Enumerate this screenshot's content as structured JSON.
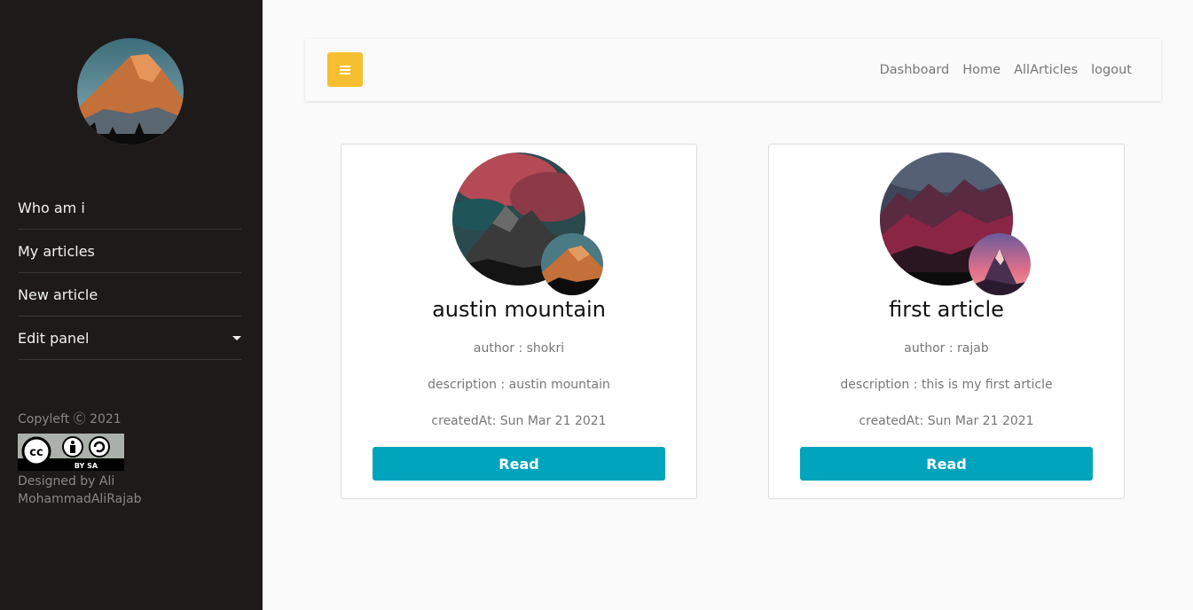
{
  "sidebar": {
    "avatar_icon": "mountain-photo",
    "items": [
      {
        "label": "Who am i"
      },
      {
        "label": "My articles"
      },
      {
        "label": "New article"
      },
      {
        "label": "Edit panel",
        "has_dropdown": true
      }
    ],
    "footer": {
      "copyleft": "Copyleft Ⓒ 2021",
      "license_badge_text": "BY SA",
      "designed_by": "Designed by Ali",
      "author": "MohammadAliRajab"
    }
  },
  "topbar": {
    "menu_icon": "hamburger-icon",
    "links": [
      "Dashboard",
      "Home",
      "AllArticles",
      "logout"
    ]
  },
  "articles": [
    {
      "title": "austin mountain",
      "author": "author : shokri",
      "description": "description : austin mountain",
      "created": "createdAt: Sun Mar 21 2021",
      "read_label": "Read"
    },
    {
      "title": "first article",
      "author": "author : rajab",
      "description": "description : this is my first article",
      "created": "createdAt: Sun Mar 21 2021",
      "read_label": "Read"
    }
  ],
  "colors": {
    "sidebar_bg": "#1e1a1a",
    "accent_yellow": "#f6bf2f",
    "read_button": "#00a4bd"
  }
}
